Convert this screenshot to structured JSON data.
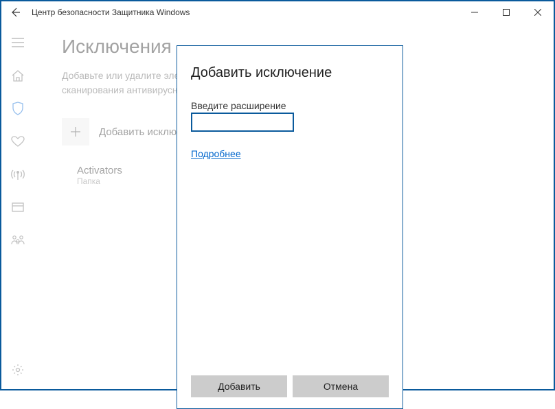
{
  "titlebar": {
    "title": "Центр безопасности Защитника Windows"
  },
  "page": {
    "heading": "Исключения",
    "desc_line1": "Добавьте или удалите элементы, которые хотите исключить из списка",
    "desc_line2": "сканирования антивирусной программы \"Защитник Windows\".",
    "add_label": "Добавить исключение"
  },
  "exclusions": [
    {
      "name": "Activators",
      "type": "Папка"
    }
  ],
  "dialog": {
    "title": "Добавить исключение",
    "label": "Введите расширение",
    "value": "",
    "more_link": "Подробнее",
    "add_btn": "Добавить",
    "cancel_btn": "Отмена"
  }
}
